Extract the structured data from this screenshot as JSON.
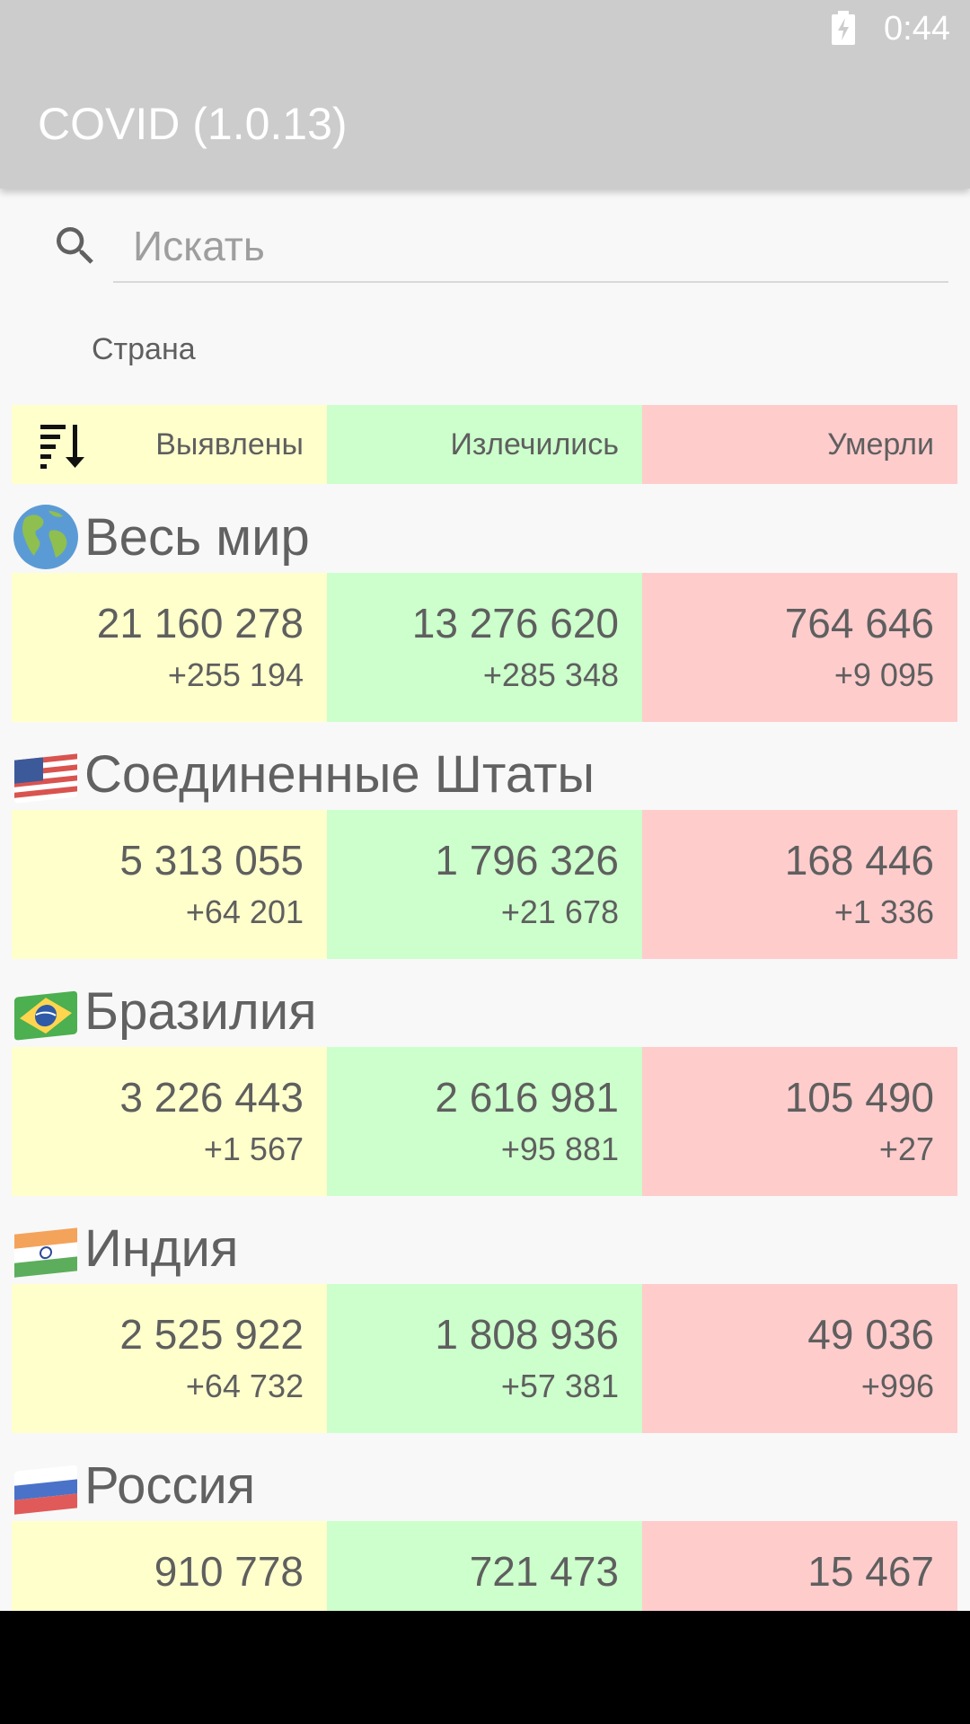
{
  "status_bar": {
    "time": "0:44",
    "battery_icon": "battery-charging-icon"
  },
  "app_bar": {
    "title": "COVID (1.0.13)"
  },
  "search": {
    "placeholder": "Искать",
    "value": "",
    "icon": "search-icon"
  },
  "filter": {
    "country_label": "Страна"
  },
  "header": {
    "sort_icon": "sort-descending-icon",
    "confirmed": "Выявлены",
    "recovered": "Излечились",
    "deaths": "Умерли"
  },
  "colors": {
    "confirmed_bg": "#ffffcc",
    "recovered_bg": "#ccffcc",
    "deaths_bg": "#ffcccc",
    "app_bar": "#cccccc",
    "text": "#5f5f5f"
  },
  "countries": [
    {
      "name": "Весь мир",
      "flag": "globe-americas-icon",
      "confirmed": "21 160 278",
      "confirmed_delta": "+255 194",
      "recovered": "13 276 620",
      "recovered_delta": "+285 348",
      "deaths": "764 646",
      "deaths_delta": "+9 095"
    },
    {
      "name": "Соединенные Штаты",
      "flag": "us-flag-icon",
      "confirmed": "5 313 055",
      "confirmed_delta": "+64 201",
      "recovered": "1 796 326",
      "recovered_delta": "+21 678",
      "deaths": "168 446",
      "deaths_delta": "+1 336"
    },
    {
      "name": "Бразилия",
      "flag": "brazil-flag-icon",
      "confirmed": "3 226 443",
      "confirmed_delta": "+1 567",
      "recovered": "2 616 981",
      "recovered_delta": "+95 881",
      "deaths": "105 490",
      "deaths_delta": "+27"
    },
    {
      "name": "Индия",
      "flag": "india-flag-icon",
      "confirmed": "2 525 922",
      "confirmed_delta": "+64 732",
      "recovered": "1 808 936",
      "recovered_delta": "+57 381",
      "deaths": "49 036",
      "deaths_delta": "+996"
    },
    {
      "name": "Россия",
      "flag": "russia-flag-icon",
      "confirmed": "910 778",
      "confirmed_delta": "",
      "recovered": "721 473",
      "recovered_delta": "",
      "deaths": "15 467",
      "deaths_delta": ""
    }
  ]
}
